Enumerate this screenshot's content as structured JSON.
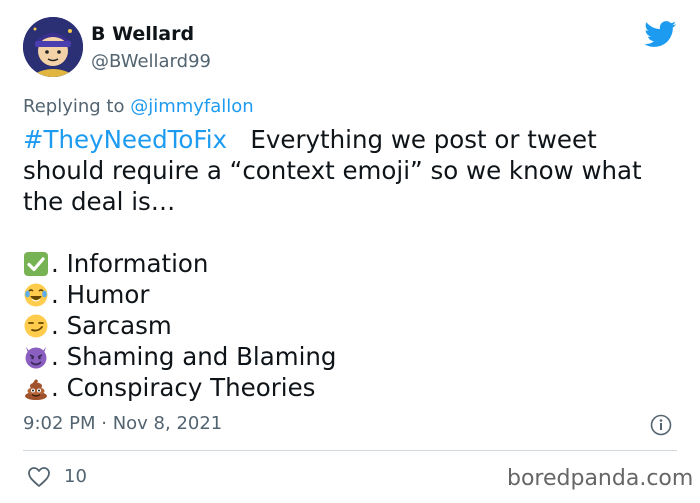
{
  "author": {
    "name": "B Wellard",
    "handle": "@BWellard99"
  },
  "reply": {
    "prefix": "Replying to ",
    "mention": "@jimmyfallon"
  },
  "tweet": {
    "hashtag": "#TheyNeedToFix",
    "line1_rest": "   Everything we post or tweet",
    "line2": "should require a “context emoji” so we know what",
    "line3": "the deal is…",
    "items": [
      {
        "emoji": "check-mark-icon",
        "text": ". Information"
      },
      {
        "emoji": "tears-of-joy-icon",
        "text": ". Humor"
      },
      {
        "emoji": "smirk-icon",
        "text": ". Sarcasm"
      },
      {
        "emoji": "smiling-devil-icon",
        "text": ". Shaming and Blaming"
      },
      {
        "emoji": "pile-of-poo-icon",
        "text": ". Conspiracy Theories"
      }
    ]
  },
  "meta": {
    "timestamp": "9:02 PM · Nov 8, 2021",
    "likes": "10"
  },
  "watermark": "boredpanda.com",
  "colors": {
    "accent": "#1d9bf0",
    "secondary_text": "#536471",
    "primary_text": "#0f1419",
    "divider": "#cfd9de"
  }
}
